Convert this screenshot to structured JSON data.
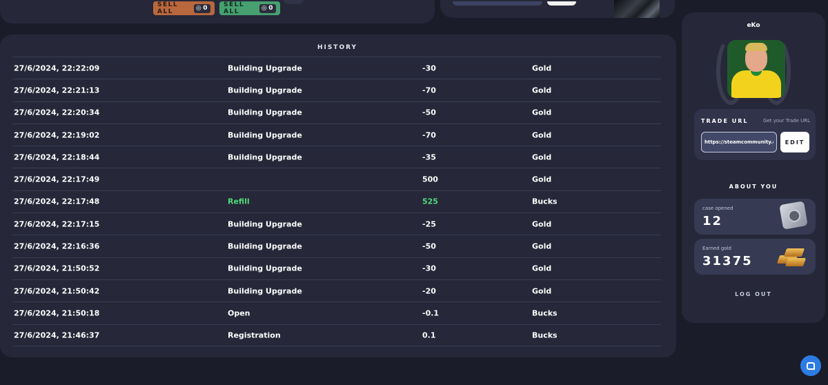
{
  "top": {
    "sell_all_orange": {
      "label": "SELL ALL",
      "count": "0"
    },
    "sell_all_green": {
      "label": "SELL ALL",
      "count": "0"
    }
  },
  "history": {
    "title": "HISTORY",
    "rows": [
      {
        "date": "27/6/2024, 22:22:09",
        "type": "Building Upgrade",
        "amount": "-30",
        "currency": "Gold"
      },
      {
        "date": "27/6/2024, 22:21:13",
        "type": "Building Upgrade",
        "amount": "-70",
        "currency": "Gold"
      },
      {
        "date": "27/6/2024, 22:20:34",
        "type": "Building Upgrade",
        "amount": "-50",
        "currency": "Gold"
      },
      {
        "date": "27/6/2024, 22:19:02",
        "type": "Building Upgrade",
        "amount": "-70",
        "currency": "Gold"
      },
      {
        "date": "27/6/2024, 22:18:44",
        "type": "Building Upgrade",
        "amount": "-35",
        "currency": "Gold"
      },
      {
        "date": "27/6/2024, 22:17:49",
        "type": "",
        "amount": "500",
        "currency": "Gold"
      },
      {
        "date": "27/6/2024, 22:17:48",
        "type": "Refill",
        "amount": "525",
        "currency": "Bucks",
        "highlight": true
      },
      {
        "date": "27/6/2024, 22:17:15",
        "type": "Building Upgrade",
        "amount": "-25",
        "currency": "Gold"
      },
      {
        "date": "27/6/2024, 22:16:36",
        "type": "Building Upgrade",
        "amount": "-50",
        "currency": "Gold"
      },
      {
        "date": "27/6/2024, 21:50:52",
        "type": "Building Upgrade",
        "amount": "-30",
        "currency": "Gold"
      },
      {
        "date": "27/6/2024, 21:50:42",
        "type": "Building Upgrade",
        "amount": "-20",
        "currency": "Gold"
      },
      {
        "date": "27/6/2024, 21:50:18",
        "type": "Open",
        "amount": "-0.1",
        "currency": "Bucks"
      },
      {
        "date": "27/6/2024, 21:46:37",
        "type": "Registration",
        "amount": "0.1",
        "currency": "Bucks"
      }
    ]
  },
  "profile": {
    "username": "eKo",
    "trade": {
      "label": "TRADE URL",
      "link": "Get your Trade URL",
      "value": "https://steamcommunity.com",
      "edit_label": "EDIT"
    },
    "about_title": "ABOUT YOU",
    "stats": [
      {
        "label": "case opened",
        "value": "12",
        "icon": "safe-icon"
      },
      {
        "label": "Earned gold",
        "value": "31375",
        "icon": "gold-bars-icon"
      }
    ],
    "logout_label": "LOG OUT"
  },
  "colors": {
    "background": "#1b1c29",
    "panel": "#262839",
    "accent_green": "#4fdc7c",
    "sell_orange": "#b9683e",
    "sell_green": "#46a070",
    "chat_blue": "#2c7ce4"
  }
}
